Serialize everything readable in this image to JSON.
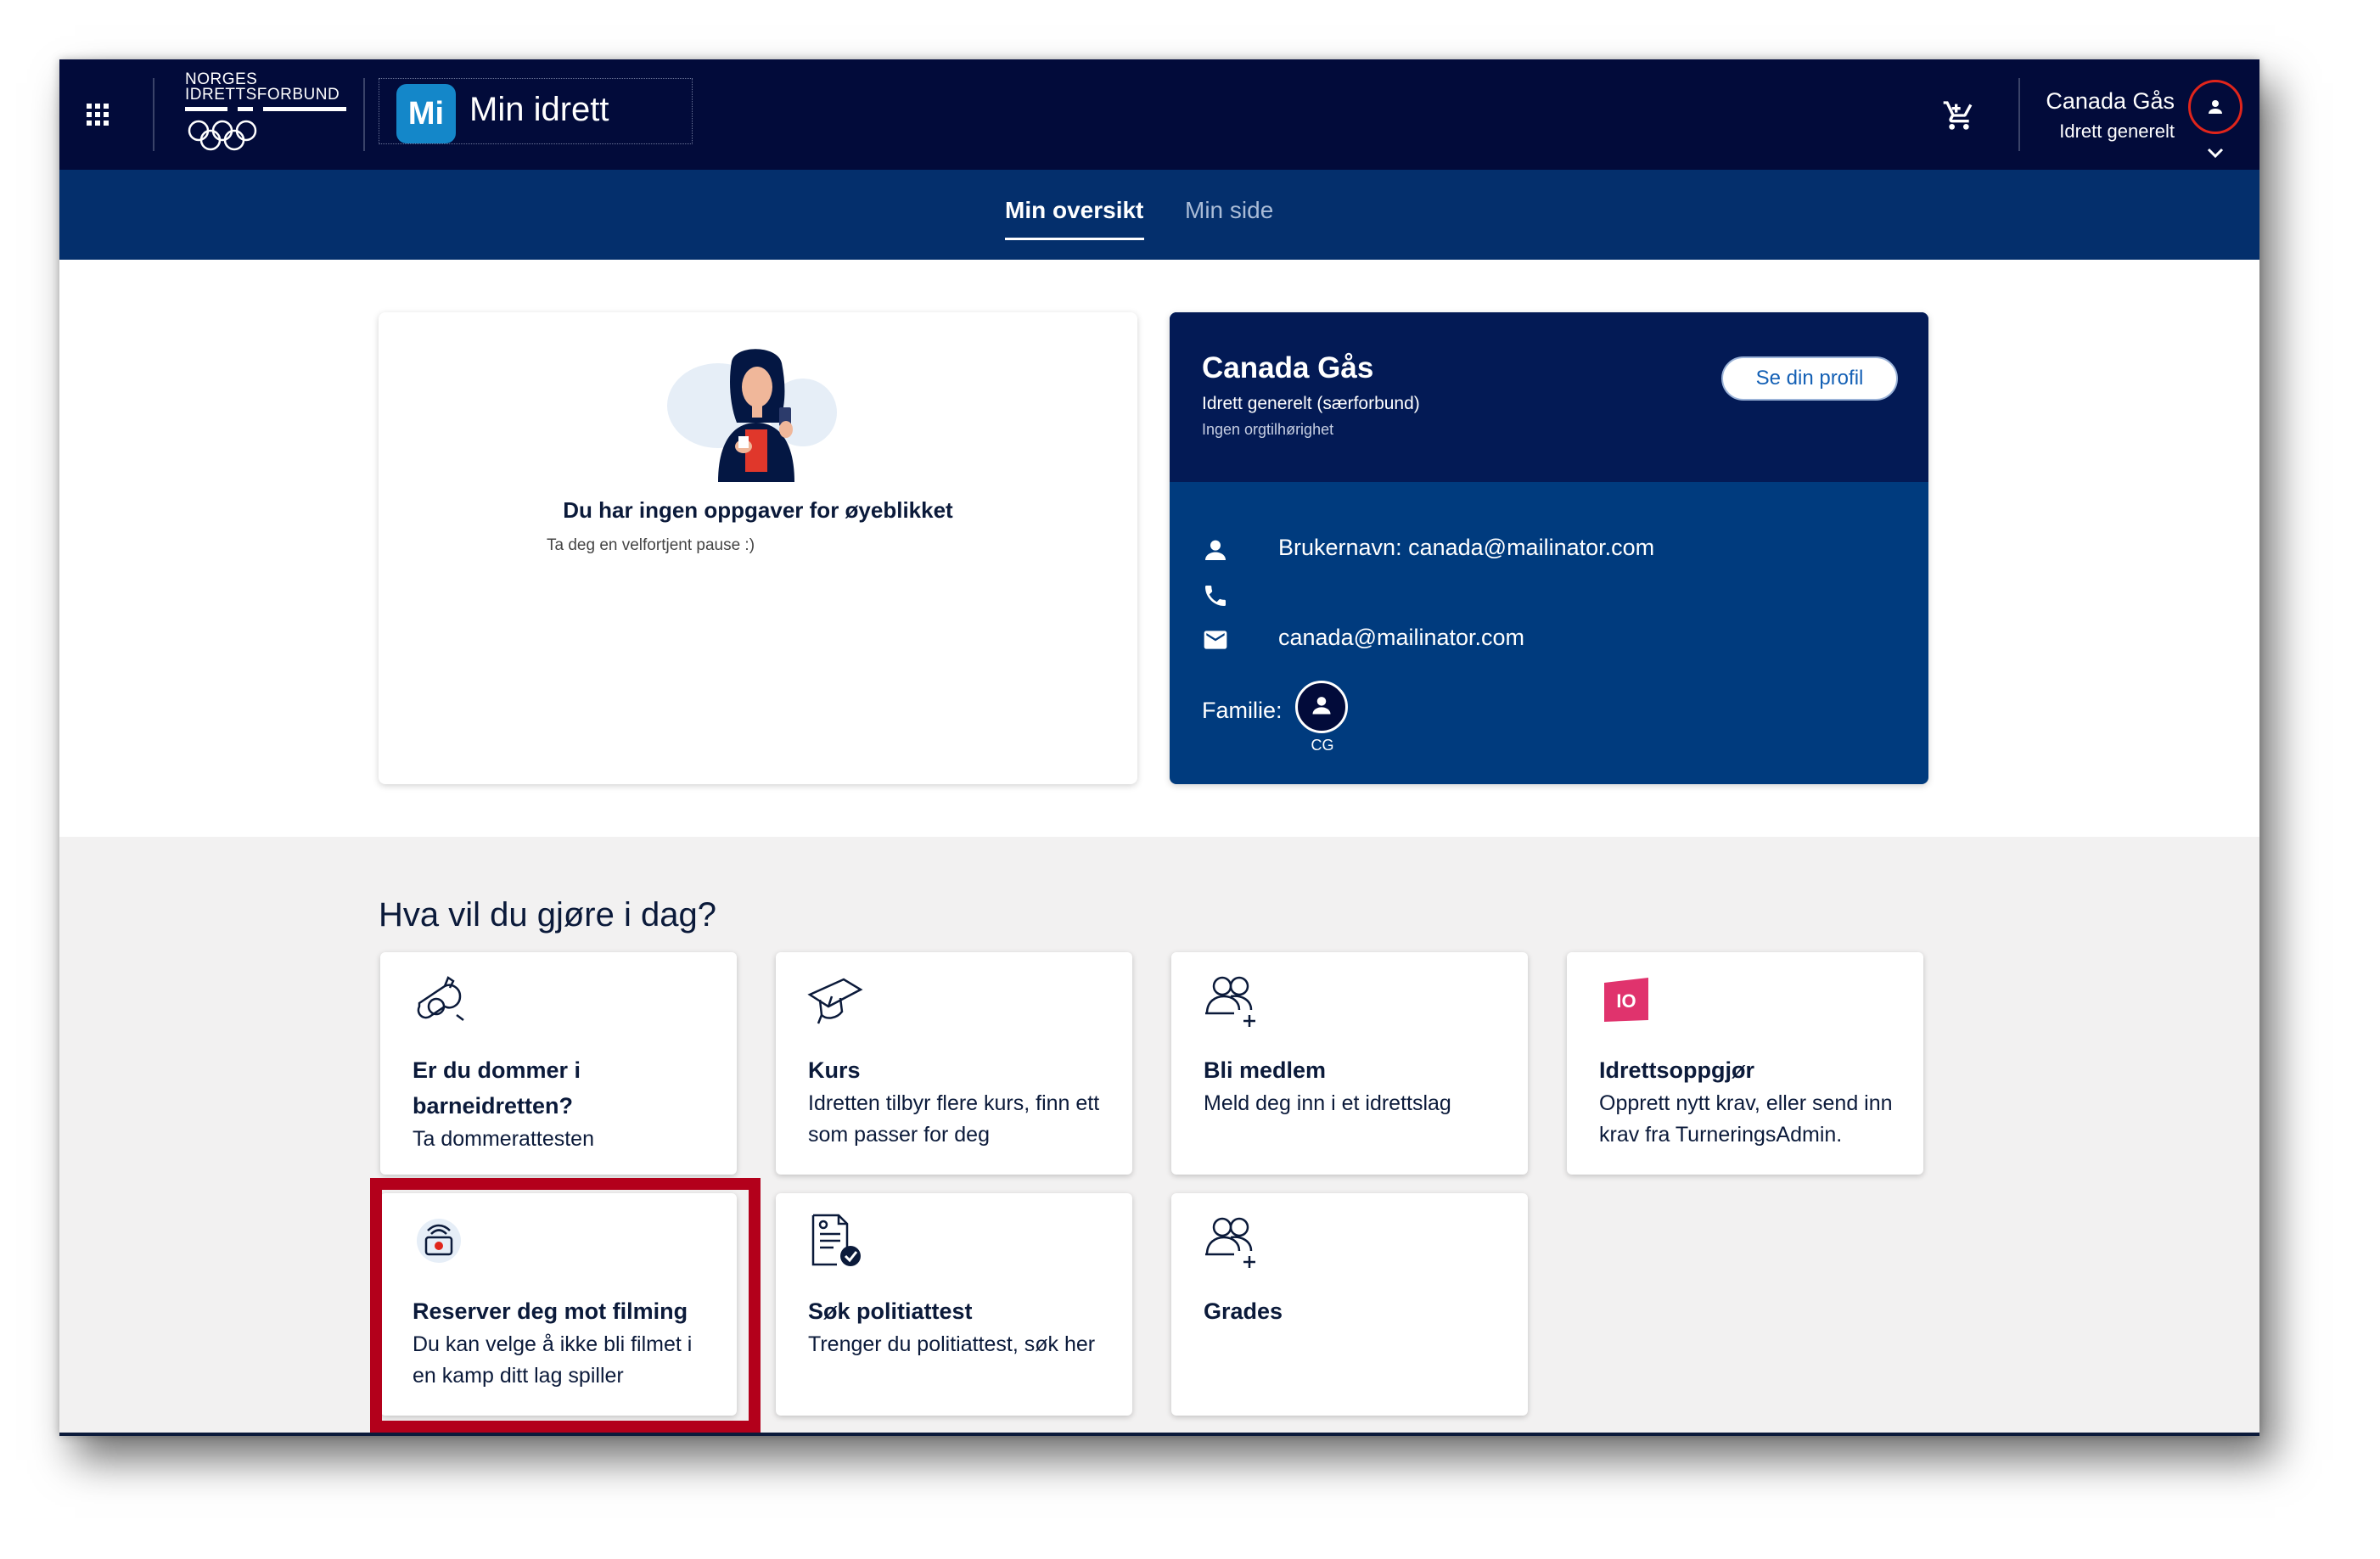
{
  "header": {
    "federation_line1": "NORGES",
    "federation_line2": "IDRETTSFORBUND",
    "app_badge": "Mi",
    "app_title": "Min idrett",
    "user_name": "Canada Gås",
    "user_org": "Idrett generelt"
  },
  "subnav": {
    "tabs": [
      {
        "label": "Min oversikt",
        "active": true
      },
      {
        "label": "Min side",
        "active": false
      }
    ]
  },
  "tasks": {
    "title": "Du har ingen oppgaver for øyeblikket",
    "subtitle": "Ta deg en velfortjent pause :)"
  },
  "profile": {
    "name": "Canada Gås",
    "org": "Idrett generelt (særforbund)",
    "org_affiliation": "Ingen orgtilhørighet",
    "button_label": "Se din profil",
    "username_label": "Brukernavn: canada@mailinator.com",
    "phone": "",
    "email": "canada@mailinator.com",
    "family_label": "Familie:",
    "family_initials": "CG"
  },
  "actions": {
    "title": "Hva vil du gjøre i dag?",
    "tiles": [
      {
        "title": "Er du dommer i barneidretten?",
        "desc": "Ta dommerattesten",
        "icon": "whistle-icon"
      },
      {
        "title": "Kurs",
        "desc": "Idretten tilbyr flere kurs, finn ett som passer for deg",
        "icon": "graduation-cap-icon"
      },
      {
        "title": "Bli medlem",
        "desc": "Meld deg inn i et idrettslag",
        "icon": "add-member-icon"
      },
      {
        "title": "Idrettsoppgjør",
        "desc": "Opprett nytt krav, eller send inn krav fra TurneringsAdmin.",
        "icon": "io-logo-icon",
        "icon_text": "IO"
      },
      {
        "title": "Reserver deg mot filming",
        "desc": "Du kan velge å ikke bli filmet i en kamp ditt lag spiller",
        "icon": "camera-icon"
      },
      {
        "title": "Søk politiattest",
        "desc": "Trenger du politiattest, søk her",
        "icon": "document-check-icon"
      },
      {
        "title": "Grades",
        "desc": "",
        "icon": "add-member-icon"
      }
    ]
  },
  "colors": {
    "header_bg": "#020b3a",
    "subnav_bg": "#042f6c",
    "profile_bg": "#003b7e",
    "highlight": "#b3001b",
    "io_pink": "#e0336d"
  }
}
